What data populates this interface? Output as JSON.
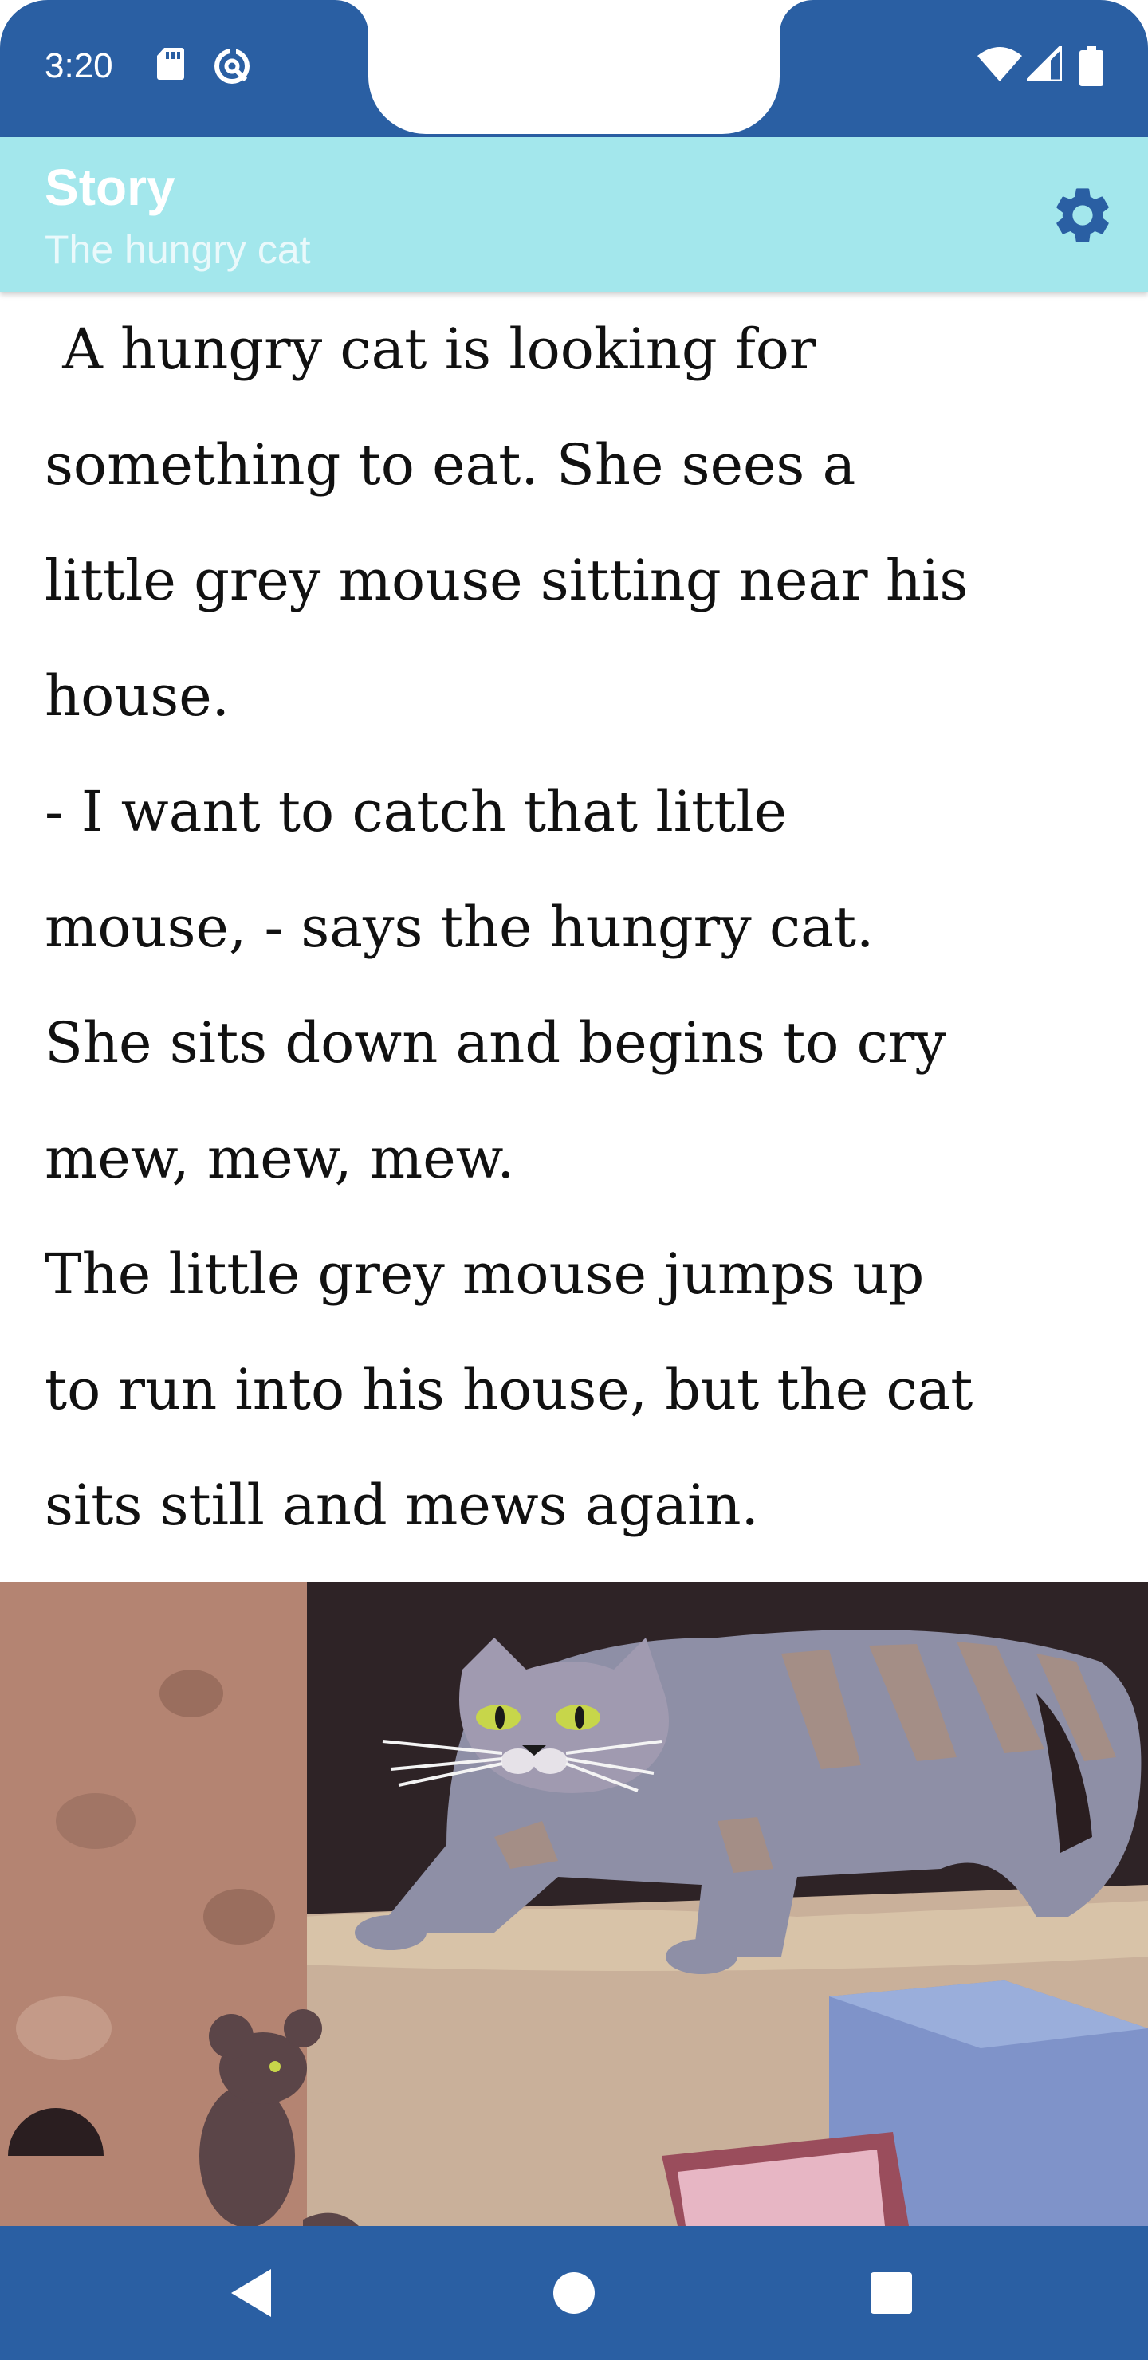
{
  "status_bar": {
    "time": "3:20",
    "icons": [
      "sd-card-icon",
      "data-saver-icon",
      "wifi-icon",
      "signal-icon",
      "battery-icon"
    ]
  },
  "app_bar": {
    "title": "Story",
    "subtitle": "The hungry cat",
    "settings_icon": "gear-icon"
  },
  "story": {
    "lines": [
      " A hungry cat is looking for",
      "something to eat. She sees a",
      "little grey mouse sitting near his",
      "house.",
      "- I want to catch that little",
      "mouse, - says the hungry cat.",
      "She sits down and begins to cry",
      "mew, mew, mew.",
      "The little grey mouse jumps up",
      "to run into his house, but the cat",
      "sits still and mews again."
    ]
  },
  "illustration": {
    "subject": "grey striped cat crouching on a wall watching a small brown mouse"
  },
  "nav_bar": {
    "icons": [
      "back-icon",
      "home-icon",
      "recents-icon"
    ]
  },
  "colors": {
    "status_bar": "#2a5fa3",
    "app_bar": "#a3e7ec",
    "settings_icon": "#2a5fa3"
  }
}
